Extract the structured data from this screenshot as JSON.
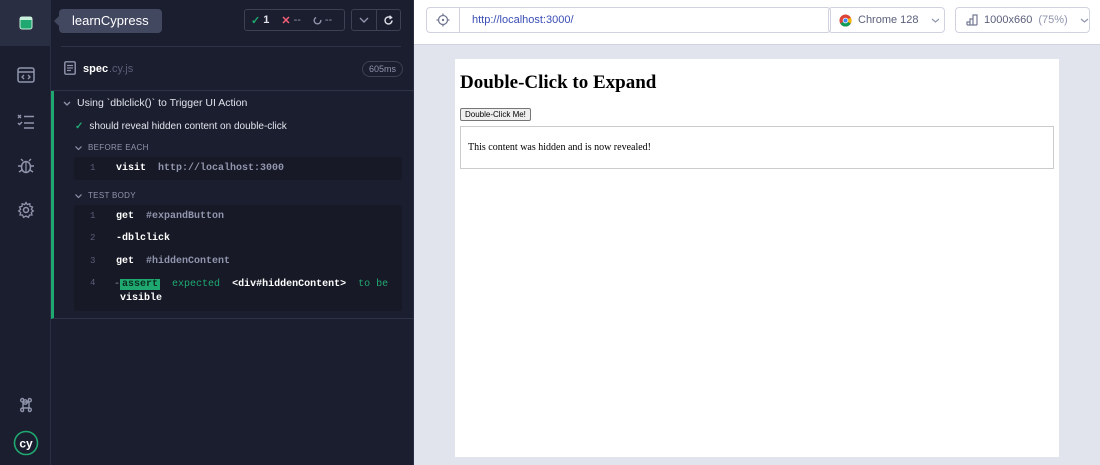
{
  "app": {
    "title": "learnCypress"
  },
  "sidebar": {
    "icons": [
      "cypress-logo-icon",
      "specs-icon",
      "runs-icon",
      "debug-icon",
      "settings-icon",
      "keyboard-shortcuts-icon",
      "cypress-cy-icon"
    ]
  },
  "reporter": {
    "stats": {
      "passed": "1",
      "failed": "--",
      "pending": "--"
    },
    "spec": {
      "name": "spec",
      "ext": ".cy.js",
      "duration": "605ms"
    },
    "suite": {
      "title": "Using `dblclick()` to Trigger UI Action",
      "test": "should reveal hidden content on double-click",
      "before_each": {
        "label": "BEFORE EACH",
        "commands": [
          {
            "num": "1",
            "name": "visit",
            "msg": "http://localhost:3000"
          }
        ]
      },
      "test_body": {
        "label": "TEST BODY",
        "commands": [
          {
            "num": "1",
            "name": "get",
            "msg": "#expandButton"
          },
          {
            "num": "2",
            "name": "-dblclick",
            "msg": ""
          },
          {
            "num": "3",
            "name": "get",
            "msg": "#hiddenContent"
          },
          {
            "num": "4",
            "prefix": "-",
            "badge": "assert",
            "expected": "expected",
            "subject": "<div#hiddenContent>",
            "to_be": "to be",
            "state": "visible"
          }
        ]
      }
    }
  },
  "aut": {
    "url": "http://localhost:3000/",
    "browser": "Chrome 128",
    "viewport": "1000x660",
    "viewport_scale": "(75%)",
    "page": {
      "heading": "Double-Click to Expand",
      "button": "Double-Click Me!",
      "revealed": "This content was hidden and is now revealed!"
    }
  },
  "colors": {
    "accent_green": "#1fa971",
    "fail_red": "#f55e78",
    "sidebar_bg": "#1b1e2e",
    "url_blue": "#3a4db5"
  }
}
